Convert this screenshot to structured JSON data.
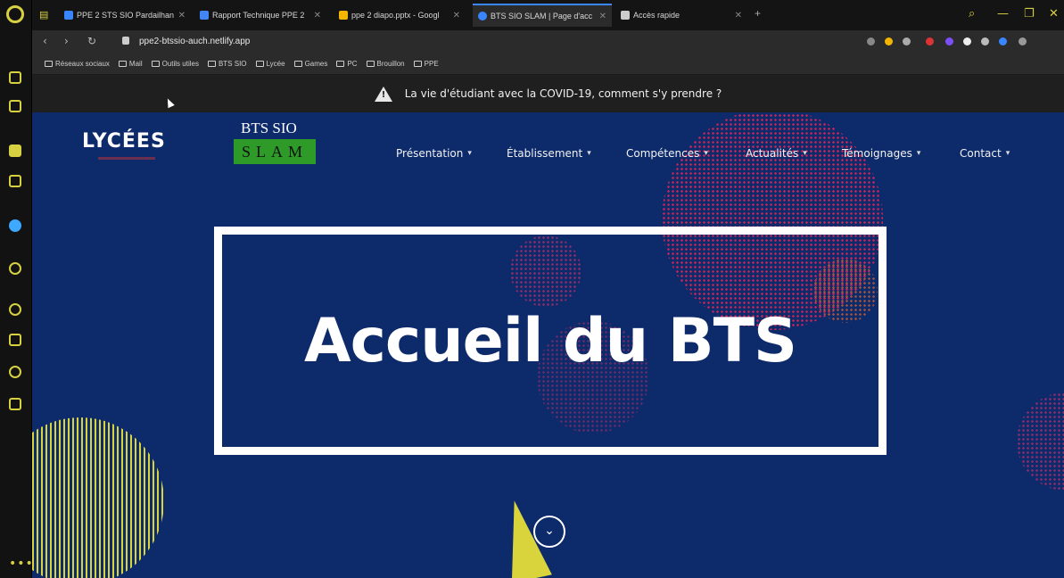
{
  "browser": {
    "tabs": [
      {
        "label": "PPE 2 STS SIO Pardailhan",
        "favicon_color": "#3a86ff"
      },
      {
        "label": "Rapport Technique PPE 2",
        "favicon_color": "#4285f4"
      },
      {
        "label": "ppe 2 diapo.pptx - Googl",
        "favicon_color": "#f4b400"
      },
      {
        "label": "BTS SIO SLAM | Page d'acc",
        "favicon_color": "#3a86ff"
      },
      {
        "label": "Accès rapide",
        "favicon_color": "#cccccc"
      }
    ],
    "url": "ppe2-btssio-auch.netlify.app",
    "bookmarks": [
      "Réseaux sociaux",
      "Mail",
      "Outils utiles",
      "BTS SIO",
      "Lycée",
      "Games",
      "PC",
      "Brouillon",
      "PPE"
    ]
  },
  "site": {
    "banner_text": "La vie d'étudiant avec la COVID-19, comment s'y prendre ?",
    "logo_lycees": "LYCÉES",
    "logo_bts": "BTS SIO",
    "logo_slam": "SLAM",
    "nav": [
      "Présentation",
      "Établissement",
      "Compétences",
      "Actualités",
      "Témoignages",
      "Contact"
    ],
    "hero_title": "Accueil du BTS"
  },
  "colors": {
    "accent": "#d7d040",
    "site_background": "#0d2a6b",
    "slam_green": "#2e9a28"
  },
  "icons": [
    "opera-gx-logo",
    "home-icon",
    "twitch-icon",
    "twitter-icon",
    "whatsapp-icon",
    "settings-icon",
    "history-icon",
    "download-icon",
    "extensions-icon",
    "warning-icon",
    "chevron-down-icon"
  ]
}
